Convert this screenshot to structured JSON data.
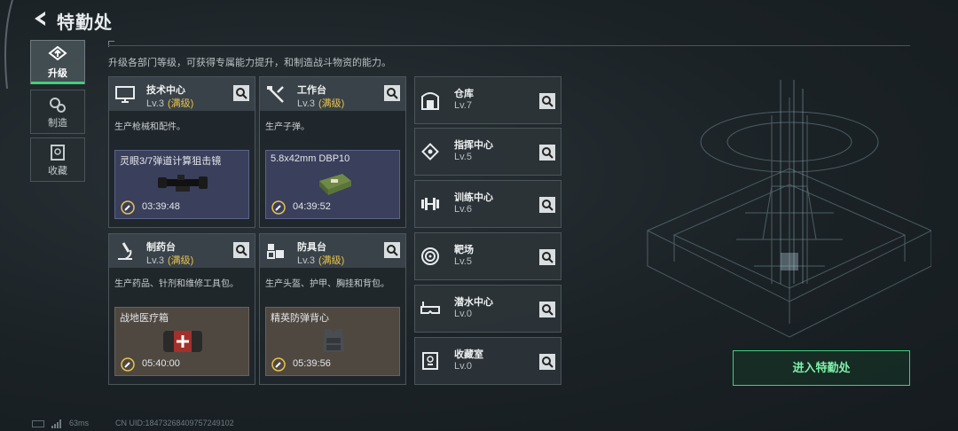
{
  "app": {
    "title": "特勤处"
  },
  "header": {
    "subtitle": "升级各部门等级，可获得专属能力提升，和制造战斗物资的能力。"
  },
  "side_tabs": [
    {
      "label": "升级",
      "icon": "upgrade-icon",
      "active": true
    },
    {
      "label": "制造",
      "icon": "gears-icon",
      "active": false
    },
    {
      "label": "收藏",
      "icon": "collection-icon",
      "active": false
    }
  ],
  "facilities": [
    {
      "name": "技术中心",
      "level": "Lv.3",
      "maxed": "(满级)",
      "desc": "生产枪械和配件。",
      "item": "灵眼3/7弹道计算狙击镜",
      "time": "03:39:48",
      "icon": "monitor-icon",
      "theme": "blue"
    },
    {
      "name": "工作台",
      "level": "Lv.3",
      "maxed": "(满级)",
      "desc": "生产子弹。",
      "item": "5.8x42mm DBP10",
      "time": "04:39:52",
      "icon": "tools-icon",
      "theme": "blue"
    },
    {
      "name": "制药台",
      "level": "Lv.3",
      "maxed": "(满级)",
      "desc": "生产药品、针剂和维修工具包。",
      "item": "战地医疗箱",
      "time": "05:40:00",
      "icon": "microscope-icon",
      "theme": "brown"
    },
    {
      "name": "防具台",
      "level": "Lv.3",
      "maxed": "(满级)",
      "desc": "生产头盔、护甲、胸挂和背包。",
      "item": "精英防弹背心",
      "time": "05:39:56",
      "icon": "armor-icon",
      "theme": "brown"
    }
  ],
  "departments": [
    {
      "name": "仓库",
      "level": "Lv.7",
      "icon": "warehouse-icon"
    },
    {
      "name": "指挥中心",
      "level": "Lv.5",
      "icon": "chip-icon"
    },
    {
      "name": "训练中心",
      "level": "Lv.6",
      "icon": "dumbbell-icon"
    },
    {
      "name": "靶场",
      "level": "Lv.5",
      "icon": "target-icon"
    },
    {
      "name": "潜水中心",
      "level": "Lv.0",
      "icon": "diving-mask-icon"
    },
    {
      "name": "收藏室",
      "level": "Lv.0",
      "icon": "trophy-icon"
    }
  ],
  "enter_button": {
    "label": "进入特勤处"
  },
  "footer": {
    "ping": "63ms",
    "uid": "CN UID:18473268409757249102"
  },
  "colors": {
    "accent_green": "#3fd07a",
    "maxed_yellow": "#e9c34b",
    "blue_slot": "#3a3f5c",
    "brown_slot": "#4f4841"
  }
}
